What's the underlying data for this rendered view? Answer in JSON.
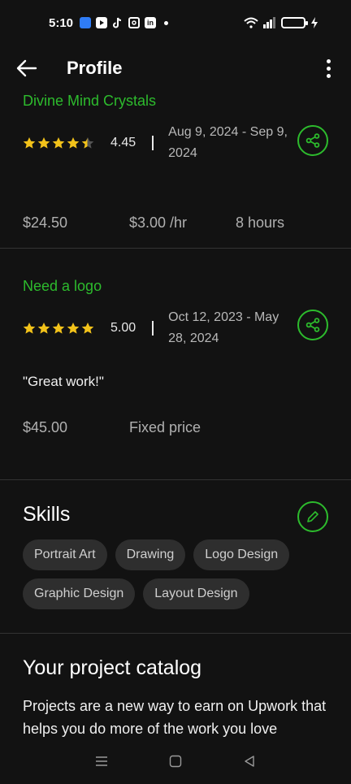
{
  "status": {
    "time": "5:10"
  },
  "header": {
    "title": "Profile"
  },
  "jobs": [
    {
      "title": "Divine Mind Crystals",
      "score": "4.45",
      "stars_fraction": 0.89,
      "dates": "Aug 9, 2024 - Sep 9, 2024",
      "review": "",
      "stats": [
        "$24.50",
        "$3.00 /hr",
        "8 hours"
      ]
    },
    {
      "title": "Need a logo",
      "score": "5.00",
      "stars_fraction": 1.0,
      "dates": "Oct 12, 2023 - May 28, 2024",
      "review": "\"Great work!\"",
      "stats": [
        "$45.00",
        "Fixed price"
      ]
    }
  ],
  "skills": {
    "title": "Skills",
    "items": [
      "Portrait Art",
      "Drawing",
      "Logo Design",
      "Graphic Design",
      "Layout Design"
    ]
  },
  "catalog": {
    "title": "Your project catalog",
    "text": "Projects are a new way to earn on Upwork that helps you do more of the work you love"
  },
  "colors": {
    "accent": "#2dbb2d",
    "star": "#f2c21a",
    "background": "#121212"
  },
  "icons": {
    "back": "arrow-left-icon",
    "more": "more-vertical-icon",
    "share": "share-icon",
    "edit": "pencil-icon",
    "nav_menu": "menu-icon",
    "nav_home": "square-icon",
    "nav_back": "triangle-back-icon"
  }
}
